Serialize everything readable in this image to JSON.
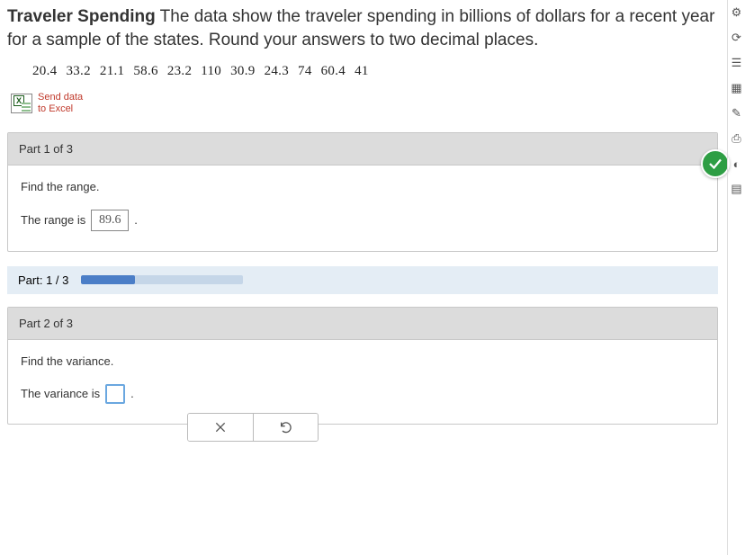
{
  "problem": {
    "title_bold": "Traveler Spending",
    "title_rest": " The data show the traveler spending in billions of dollars for a recent year for a sample of the states. Round your answers to two decimal places.",
    "data_values": [
      "20.4",
      "33.2",
      "21.1",
      "58.6",
      "23.2",
      "110",
      "30.9",
      "24.3",
      "74",
      "60.4",
      "41"
    ]
  },
  "excel_link": {
    "line1": "Send data",
    "line2": "to Excel"
  },
  "part1": {
    "header": "Part 1 of 3",
    "instruction": "Find the range.",
    "answer_prefix": "The range is",
    "answer_value": "89.6",
    "answer_suffix": "."
  },
  "progress": {
    "label": "Part: 1 / 3",
    "pct": 33
  },
  "part2": {
    "header": "Part 2 of 3",
    "instruction": "Find the variance.",
    "answer_prefix": "The variance is",
    "answer_suffix": "."
  },
  "rail_icons": [
    "settings-icon",
    "refresh-icon",
    "list-icon",
    "calculator-icon",
    "pencil-icon",
    "printer-icon",
    "theme-icon",
    "grid-icon"
  ]
}
